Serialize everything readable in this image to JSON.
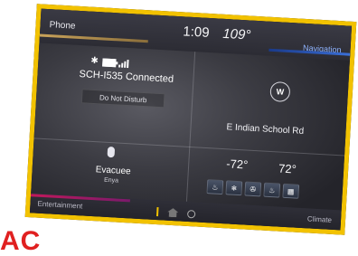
{
  "header": {
    "phone_tab": "Phone",
    "time": "1:09",
    "outside_temp": "109°",
    "navigation_tab": "Navigation"
  },
  "phone": {
    "status": "SCH-I535 Connected",
    "dnd_label": "Do Not Disturb"
  },
  "navigation": {
    "compass_heading": "W",
    "street": "E Indian School Rd"
  },
  "media": {
    "track": "Evacuee",
    "artist": "Enya"
  },
  "climate": {
    "driver_temp": "-72°",
    "passenger_temp": "72°",
    "buttons": [
      "seat-heat-left",
      "seat-cool-left",
      "fan",
      "seat-heat-right",
      "rear-defrost"
    ]
  },
  "footer": {
    "entertainment_tab": "Entertainment",
    "climate_tab": "Climate"
  },
  "colors": {
    "frame_border": "#f2c200",
    "entertainment_accent": "#c2185b",
    "navigation_accent": "#3a6fd8",
    "phone_accent": "#c9a35a",
    "logo_red": "#e02020"
  },
  "logo_text": "AC"
}
